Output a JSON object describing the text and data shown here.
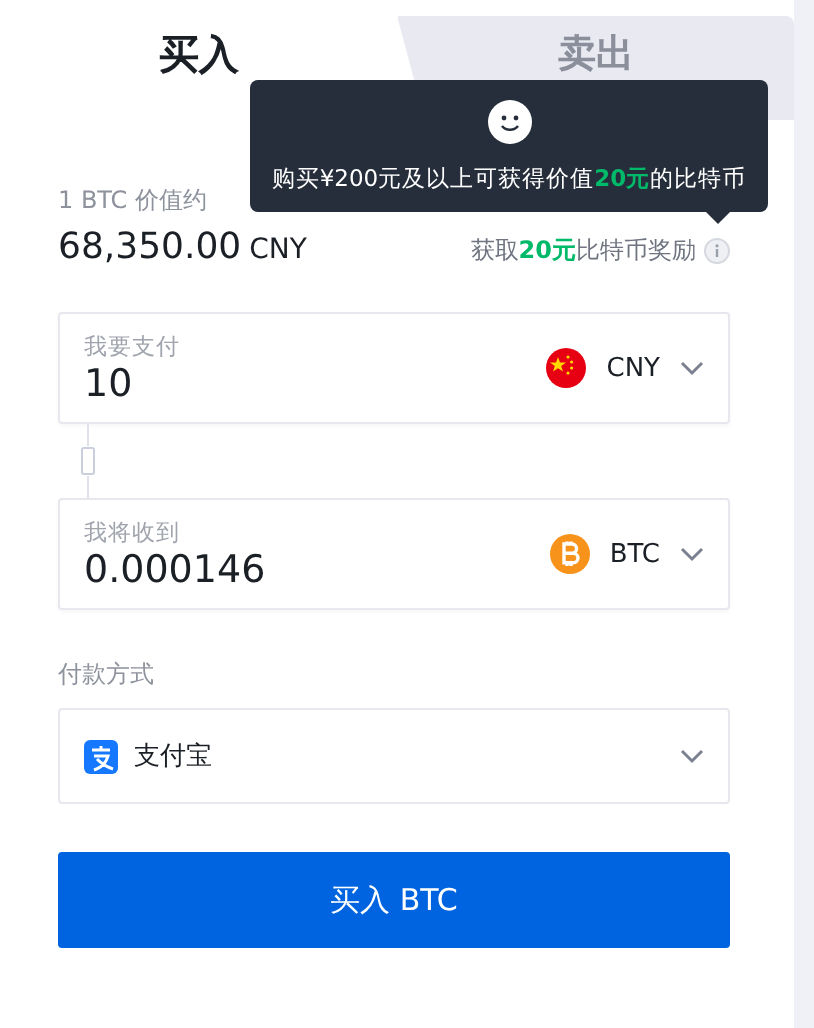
{
  "tabs": [
    {
      "label": "买入",
      "selected": true
    },
    {
      "label": "卖出",
      "selected": false
    }
  ],
  "tooltip": {
    "parts": [
      {
        "text": "购买¥200元及以上可获得价值",
        "highlight": false
      },
      {
        "text": "20元",
        "highlight": true
      },
      {
        "text": "的比特币",
        "highlight": false
      }
    ]
  },
  "rate": {
    "label": "1 BTC 价值约",
    "amount": "68,350.00",
    "currency": "CNY"
  },
  "reward": {
    "parts": [
      {
        "text": "获取",
        "highlight": false
      },
      {
        "text": "20元",
        "highlight": true
      },
      {
        "text": "比特币奖励",
        "highlight": false
      }
    ]
  },
  "pay": {
    "label": "我要支付",
    "value": "10",
    "currency": "CNY",
    "kind": "fiat"
  },
  "receive": {
    "label": "我将收到",
    "value": "0.000146",
    "currency": "BTC",
    "kind": "crypto"
  },
  "payment": {
    "label": "付款方式",
    "method": "支付宝"
  },
  "submit": "买入 BTC"
}
